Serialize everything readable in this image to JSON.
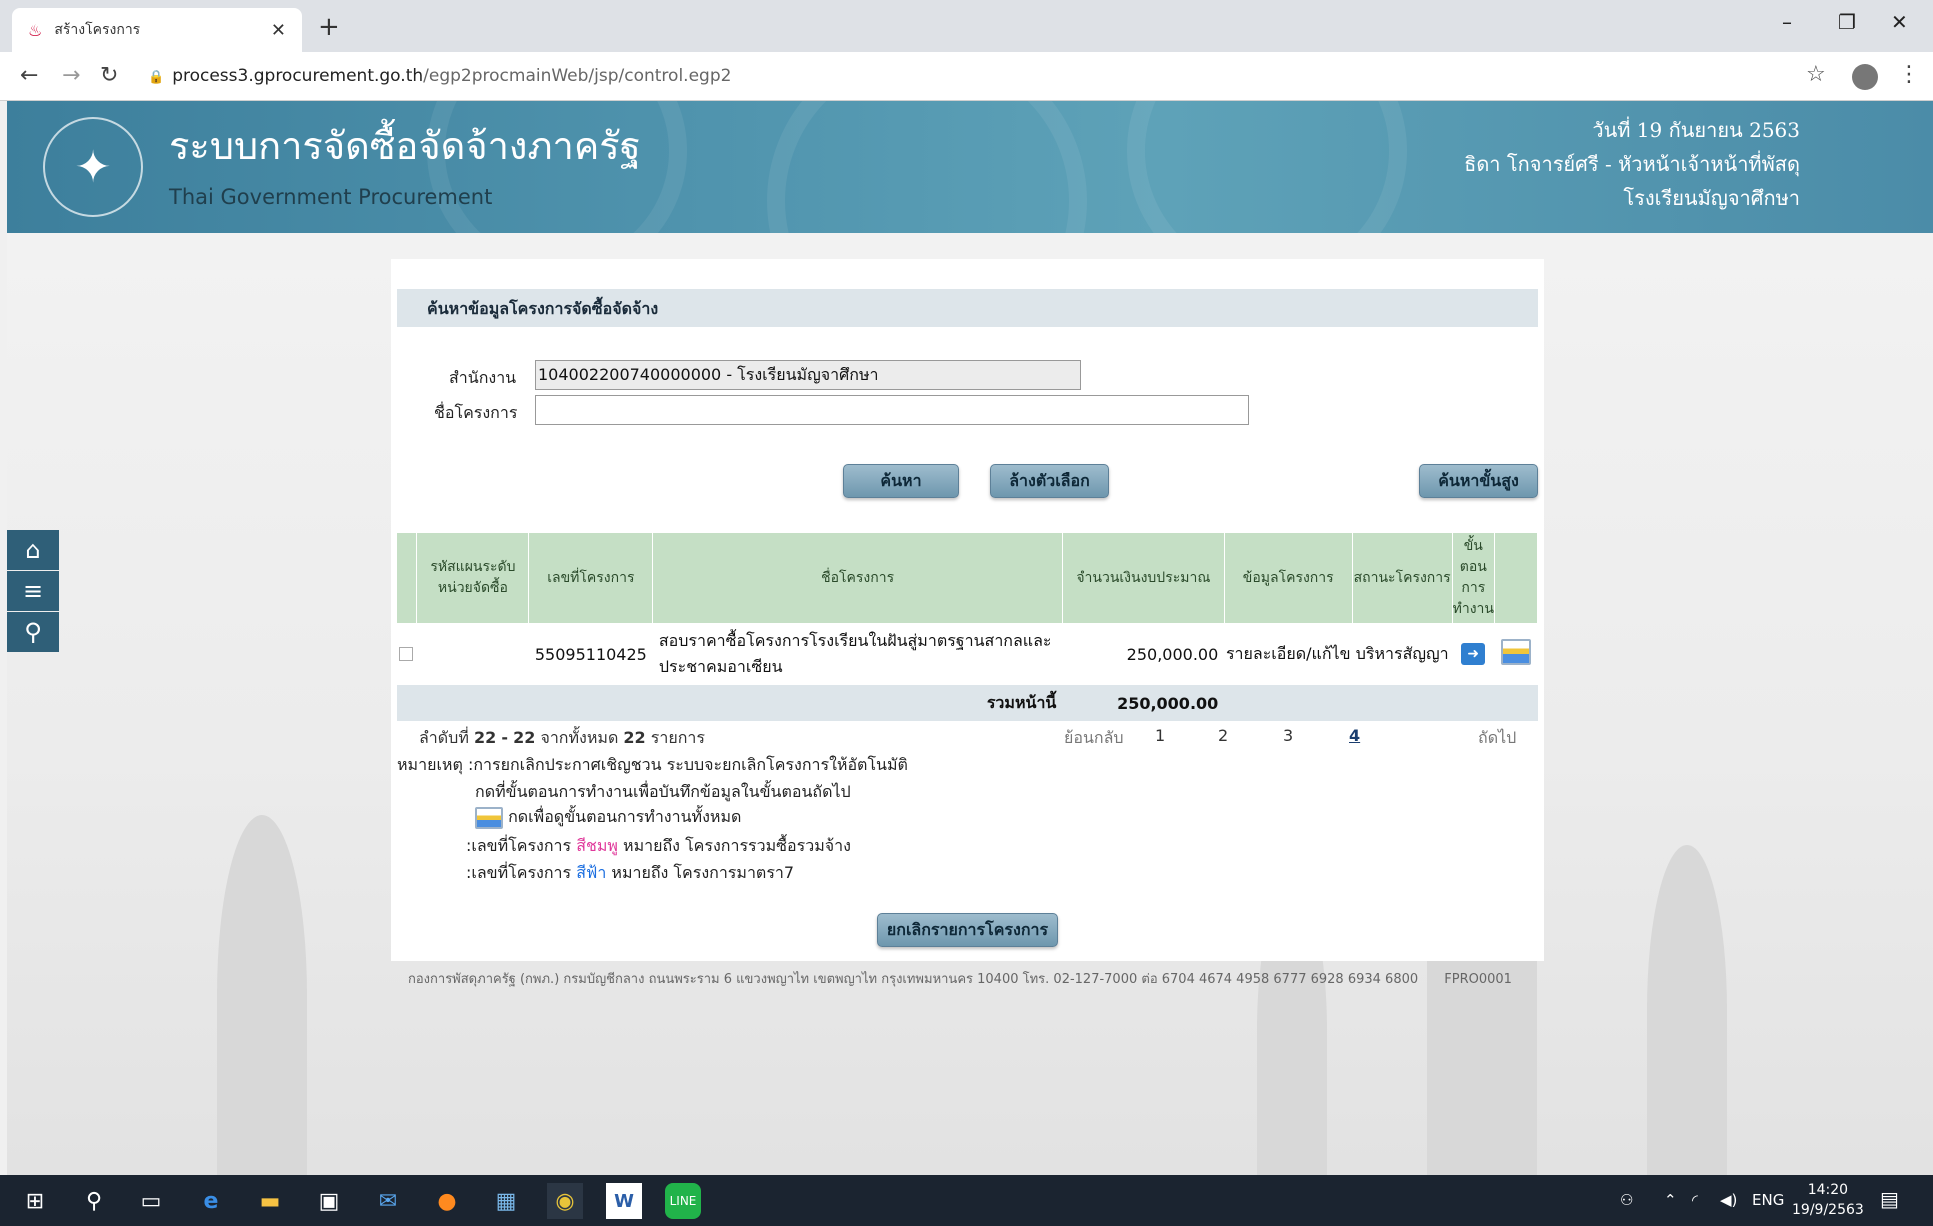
{
  "browser": {
    "tab_title": "สร้างโครงการ",
    "url_host": "process3.gprocurement.go.th",
    "url_path": "/egp2procmainWeb/jsp/control.egp2"
  },
  "header": {
    "title_th": "ระบบการจัดซื้อจัดจ้างภาครัฐ",
    "title_en": "Thai Government Procurement",
    "date": "วันที่ 19 กันยายน 2563",
    "user": "ธิดา โกจารย์ศรี - หัวหน้าเจ้าหน้าที่พัสดุ",
    "org": "โรงเรียนมัญจาศึกษา"
  },
  "search": {
    "heading": "ค้นหาข้อมูลโครงการจัดซื้อจัดจ้าง",
    "office_label": "สำนักงาน",
    "office_value": "104002200740000000 - โรงเรียนมัญจาศึกษา",
    "project_label": "ชื่อโครงการ",
    "project_value": "",
    "btn_search": "ค้นหา",
    "btn_clear": "ล้างตัวเลือก",
    "btn_advanced": "ค้นหาขั้นสูง"
  },
  "table": {
    "headers": {
      "plan_code": "รหัสแผนระดับหน่วยจัดซื้อ",
      "project_no": "เลขที่โครงการ",
      "project_name": "ชื่อโครงการ",
      "budget": "จำนวนเงินงบประมาณ",
      "info": "ข้อมูลโครงการ",
      "status": "สถานะโครงการ",
      "step": "ขั้นตอนการทำงาน"
    },
    "rows": [
      {
        "plan_code": "",
        "project_no": "55095110425",
        "project_name": "สอบราคาซื้อโครงการโรงเรียนในฝันสู่มาตรฐานสากลและประชาคมอาเซียน",
        "budget": "250,000.00",
        "info": "รายละเอียด/แก้ไข",
        "status": "บริหารสัญญา"
      }
    ],
    "sum_label": "รวมหน้านี้",
    "sum_value": "250,000.00"
  },
  "pager": {
    "summary_pre": "ลำดับที่",
    "range_start": "22",
    "dash": "-",
    "range_end": "22",
    "summary_mid": "จากทั้งหมด",
    "total": "22",
    "summary_post": "รายการ",
    "prev": "ย้อนกลับ",
    "pages": [
      "1",
      "2",
      "3",
      "4"
    ],
    "current": "4",
    "next": "ถัดไป"
  },
  "notes": {
    "line1": "หมายเหตุ :การยกเลิกประกาศเชิญชวน ระบบจะยกเลิกโครงการให้อัตโนมัติ",
    "line2": "กดที่ขั้นตอนการทำงานเพื่อบันทึกข้อมูลในขั้นตอนถัดไป",
    "line3": "กดเพื่อดูขั้นตอนการทำงานทั้งหมด",
    "line4_pre": ":เลขที่โครงการ",
    "line4_color": "สีชมพู",
    "line4_post": "หมายถึง โครงการรวมซื้อรวมจ้าง",
    "line5_pre": ":เลขที่โครงการ",
    "line5_color": "สีฟ้า",
    "line5_post": "หมายถึง โครงการมาตรา7"
  },
  "cancel_button": "ยกเลิกรายการโครงการ",
  "footer": "กองการพัสดุภาครัฐ (กพภ.) กรมบัญชีกลาง ถนนพระราม 6 แขวงพญาไท เขตพญาไท กรุงเทพมหานคร 10400 โทร. 02-127-7000 ต่อ 6704 4674 4958 6777 6928 6934 6800",
  "footer_code": "FPRO0001",
  "taskbar": {
    "lang": "ENG",
    "time": "14:20",
    "date": "19/9/2563"
  }
}
